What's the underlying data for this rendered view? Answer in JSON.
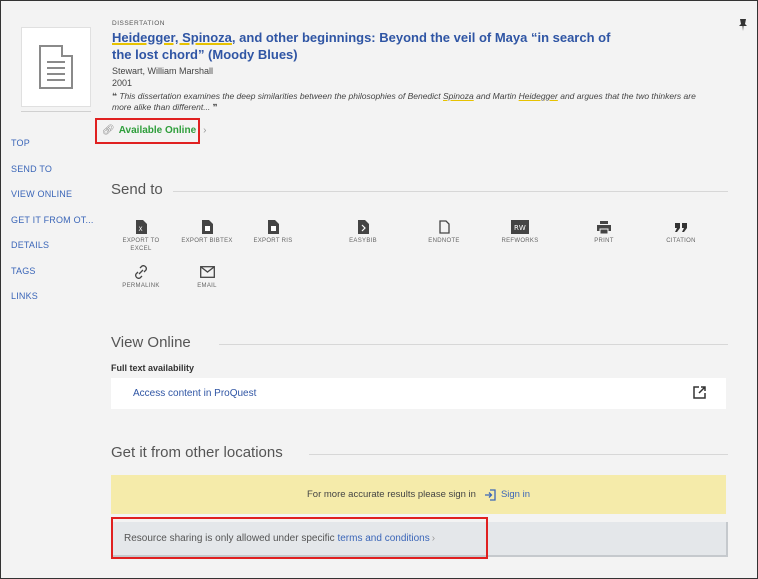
{
  "record": {
    "type": "DISSERTATION",
    "title_part1": "Heidegger, Spinoza",
    "title_part2": ", and other beginnings: Beyond the veil of Maya “in search of the lost chord” (Moody Blues)",
    "author": "Stewart, William Marshall",
    "year": "2001",
    "desc_open": "❝",
    "desc_part1": " This dissertation examines the deep similarities between the philosophies of Benedict ",
    "desc_spinoza": "Spinoza",
    "desc_part2": " and Martin ",
    "desc_heidegger": "Heidegger",
    "desc_part3": " and argues that the two thinkers are more alike than different...",
    "desc_close": " ❞",
    "available_label": "Available Online",
    "available_chevron": "›"
  },
  "nav": {
    "items": [
      {
        "label": "TOP"
      },
      {
        "label": "SEND TO"
      },
      {
        "label": "VIEW ONLINE"
      },
      {
        "label": "GET IT FROM OT..."
      },
      {
        "label": "DETAILS"
      },
      {
        "label": "TAGS"
      },
      {
        "label": "LINKS"
      }
    ]
  },
  "send_to": {
    "heading": "Send to",
    "items": [
      {
        "label": "EXPORT TO EXCEL",
        "icon": "excel-icon"
      },
      {
        "label": "EXPORT BIBTEX",
        "icon": "bibtex-icon"
      },
      {
        "label": "EXPORT RIS",
        "icon": "ris-icon"
      },
      {
        "label": "EASYBIB",
        "icon": "easybib-icon"
      },
      {
        "label": "ENDNOTE",
        "icon": "endnote-icon"
      },
      {
        "label": "REFWORKS",
        "icon": "refworks-icon"
      },
      {
        "label": "PRINT",
        "icon": "print-icon"
      },
      {
        "label": "CITATION",
        "icon": "citation-icon"
      },
      {
        "label": "PERMALINK",
        "icon": "permalink-icon"
      },
      {
        "label": "EMAIL",
        "icon": "email-icon"
      }
    ]
  },
  "view_online": {
    "heading": "View Online",
    "fulltext_label": "Full text availability",
    "access_label": "Access content in ProQuest"
  },
  "get_it": {
    "heading": "Get it from other locations",
    "signin_prompt": "For more accurate results please sign in",
    "signin_label": "Sign in",
    "share_text": "Resource sharing is only allowed under specific ",
    "share_link": "terms and conditions",
    "share_chevron": "›"
  },
  "colors": {
    "accent": "#2f55a4",
    "available_green": "#2e9e3b",
    "highlight_red": "#e02020",
    "signin_bg": "#f5ebaa"
  }
}
